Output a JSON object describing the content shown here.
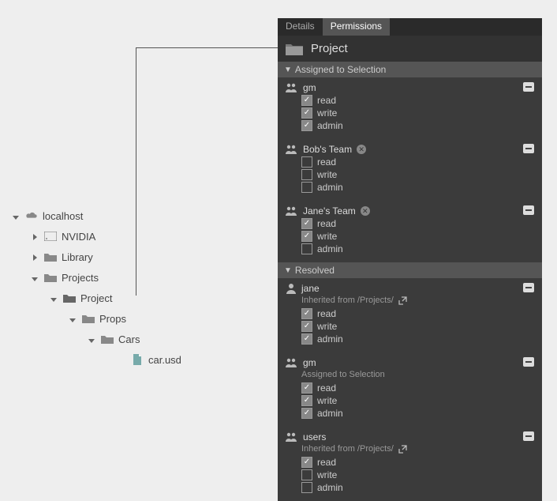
{
  "tree": {
    "root": "localhost",
    "items": [
      "NVIDIA",
      "Library",
      "Projects"
    ],
    "project": "Project",
    "props": "Props",
    "cars": "Cars",
    "file": "car.usd"
  },
  "panel": {
    "tabs": [
      "Details",
      "Permissions"
    ],
    "title": "Project",
    "sect_assigned": "Assigned to Selection",
    "sect_resolved": "Resolved",
    "groups_assigned": [
      {
        "name": "gm",
        "type": "group",
        "removable": false,
        "perms": {
          "read": true,
          "write": true,
          "admin": true
        }
      },
      {
        "name": "Bob's Team",
        "type": "group",
        "removable": true,
        "perms": {
          "read": false,
          "write": false,
          "admin": false
        }
      },
      {
        "name": "Jane's Team",
        "type": "group",
        "removable": true,
        "perms": {
          "read": true,
          "write": true,
          "admin": false
        }
      }
    ],
    "groups_resolved": [
      {
        "name": "jane",
        "type": "user",
        "sub": "Inherited from /Projects/",
        "perms": {
          "read": true,
          "write": true,
          "admin": true
        }
      },
      {
        "name": "gm",
        "type": "group",
        "sub": "Assigned to Selection",
        "perms": {
          "read": true,
          "write": true,
          "admin": true
        }
      },
      {
        "name": "users",
        "type": "group",
        "sub": "Inherited from /Projects/",
        "perms": {
          "read": true,
          "write": false,
          "admin": false
        }
      }
    ],
    "perm_labels": {
      "read": "read",
      "write": "write",
      "admin": "admin"
    }
  }
}
